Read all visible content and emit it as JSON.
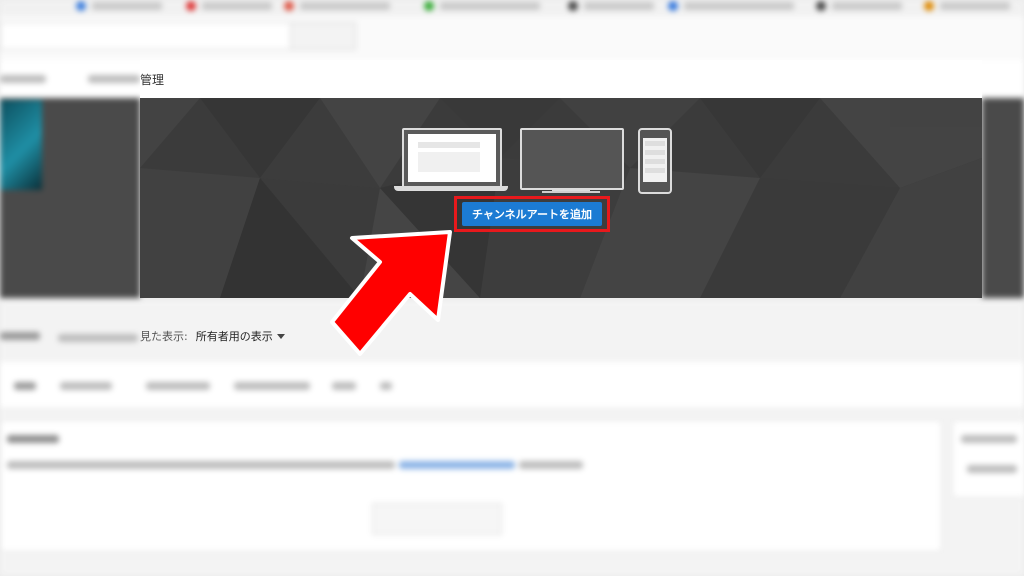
{
  "header": {
    "manage_label": "管理"
  },
  "banner": {
    "add_channel_art_button": "チャンネルアートを追加",
    "devices": [
      "laptop-icon",
      "tv-icon",
      "phone-icon"
    ]
  },
  "view_as": {
    "label": "見た表示:",
    "selected": "所有者用の表示"
  },
  "colors": {
    "button_blue": "#1c7bd3",
    "highlight_red": "#e8191c",
    "banner_dark": "#3b3b3b"
  }
}
